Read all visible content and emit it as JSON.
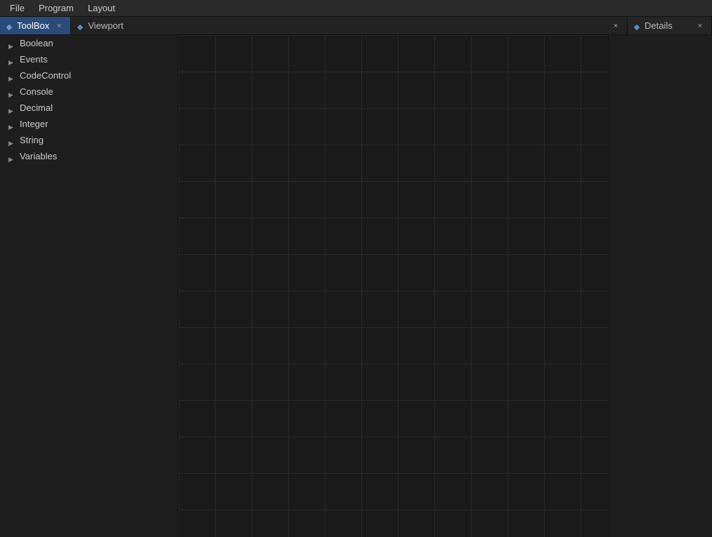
{
  "menubar": {
    "items": [
      "File",
      "Program",
      "Layout"
    ]
  },
  "tabs": {
    "toolbox": {
      "label": "ToolBox",
      "icon": "toolbox-icon",
      "active": true,
      "close_label": "×"
    },
    "viewport": {
      "label": "Viewport",
      "icon": "viewport-icon",
      "active": false,
      "close_label": "×"
    },
    "details": {
      "label": "Details",
      "icon": "details-icon",
      "active": false,
      "close_label": "×"
    }
  },
  "toolbox": {
    "items": [
      {
        "label": "Boolean"
      },
      {
        "label": "Events"
      },
      {
        "label": "CodeControl"
      },
      {
        "label": "Console"
      },
      {
        "label": "Decimal"
      },
      {
        "label": "Integer"
      },
      {
        "label": "String"
      },
      {
        "label": "Variables"
      }
    ]
  }
}
